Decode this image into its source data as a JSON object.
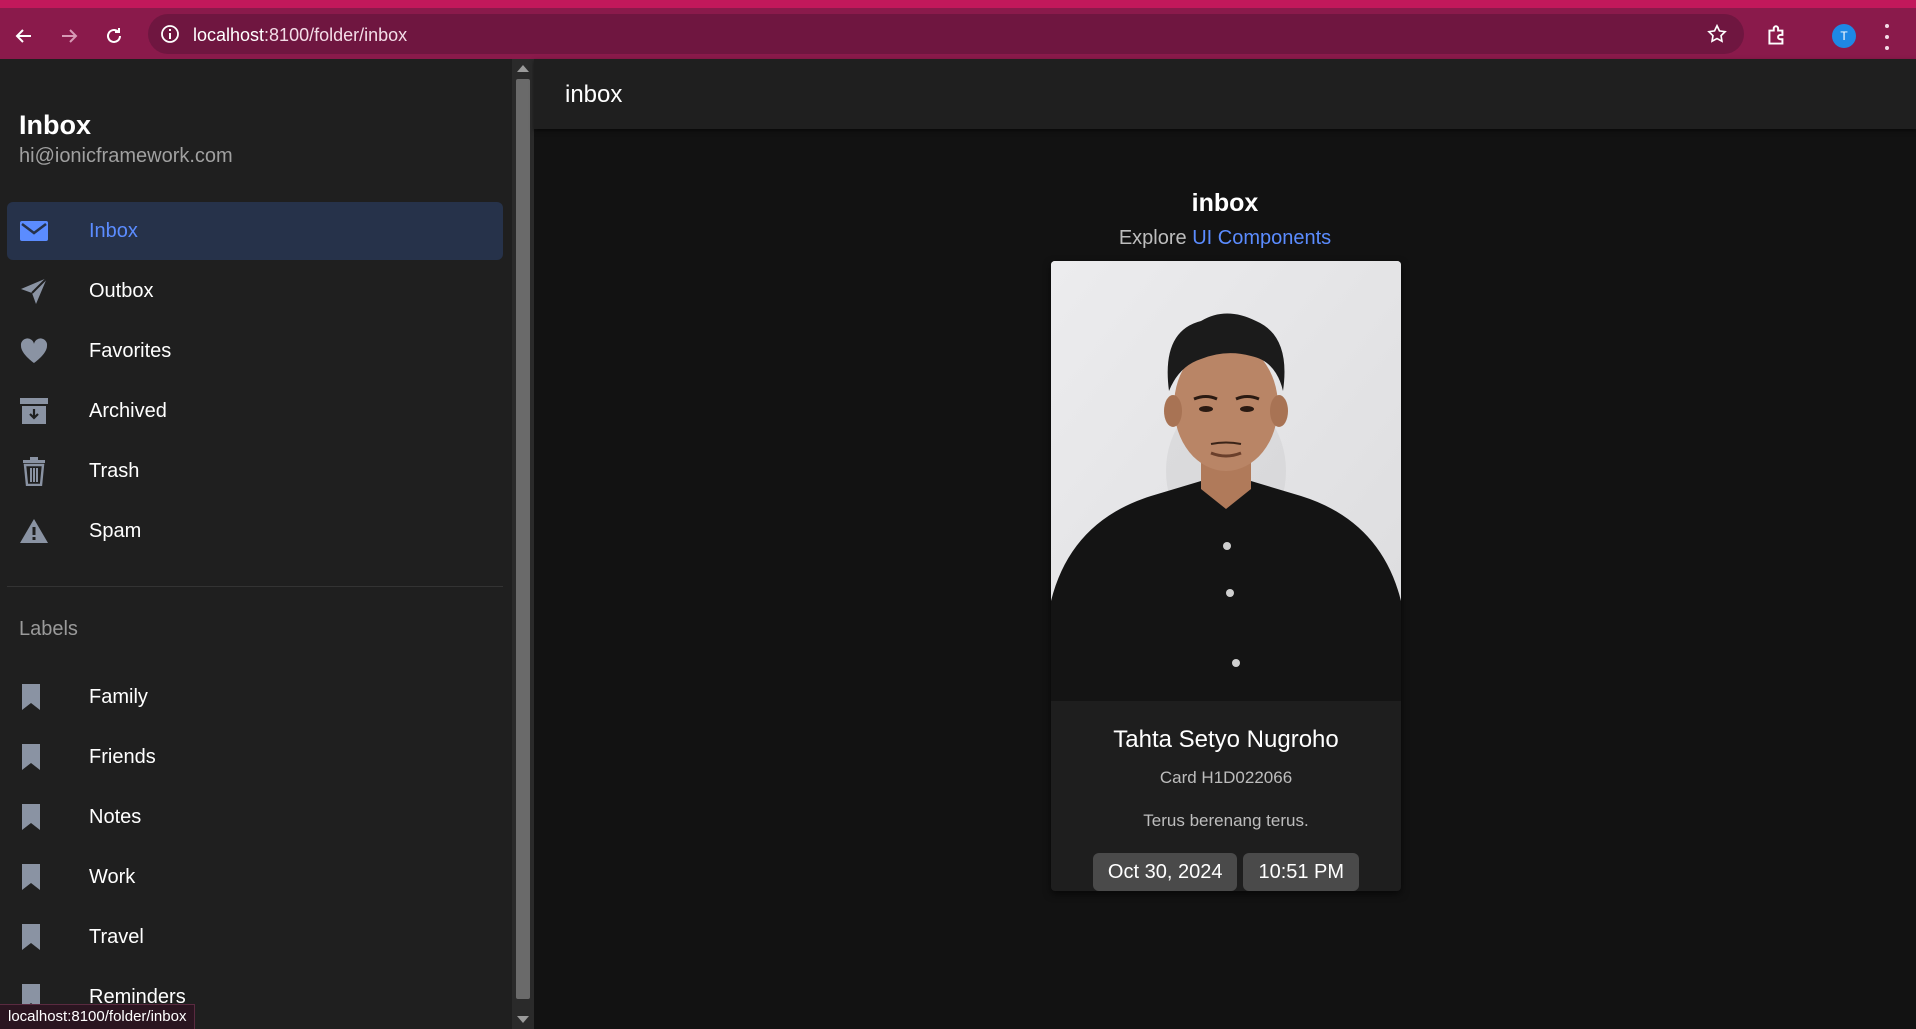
{
  "browser": {
    "url_host": "localhost",
    "url_rest": ":8100/folder/inbox",
    "avatar_letter": "T",
    "status_url": "localhost:8100/folder/inbox"
  },
  "menu": {
    "title": "Inbox",
    "email": "hi@ionicframework.com",
    "items": [
      {
        "label": "Inbox",
        "icon": "mail-icon",
        "active": true
      },
      {
        "label": "Outbox",
        "icon": "paper-plane-icon"
      },
      {
        "label": "Favorites",
        "icon": "heart-icon"
      },
      {
        "label": "Archived",
        "icon": "archive-icon"
      },
      {
        "label": "Trash",
        "icon": "trash-icon"
      },
      {
        "label": "Spam",
        "icon": "warning-icon"
      }
    ],
    "labels_heading": "Labels",
    "labels": [
      "Family",
      "Friends",
      "Notes",
      "Work",
      "Travel",
      "Reminders"
    ]
  },
  "toolbar": {
    "title": "inbox"
  },
  "content": {
    "title": "inbox",
    "explore_prefix": "Explore",
    "explore_link": "UI Components"
  },
  "card": {
    "name": "Tahta Setyo Nugroho",
    "subtitle": "Card H1D022066",
    "text": "Terus berenang terus.",
    "date": "Oct 30, 2024",
    "time": "10:51 PM"
  },
  "colors": {
    "accent": "#5b8cff",
    "chrome": "#8a1a4b",
    "active_item_bg": "#26324a"
  }
}
